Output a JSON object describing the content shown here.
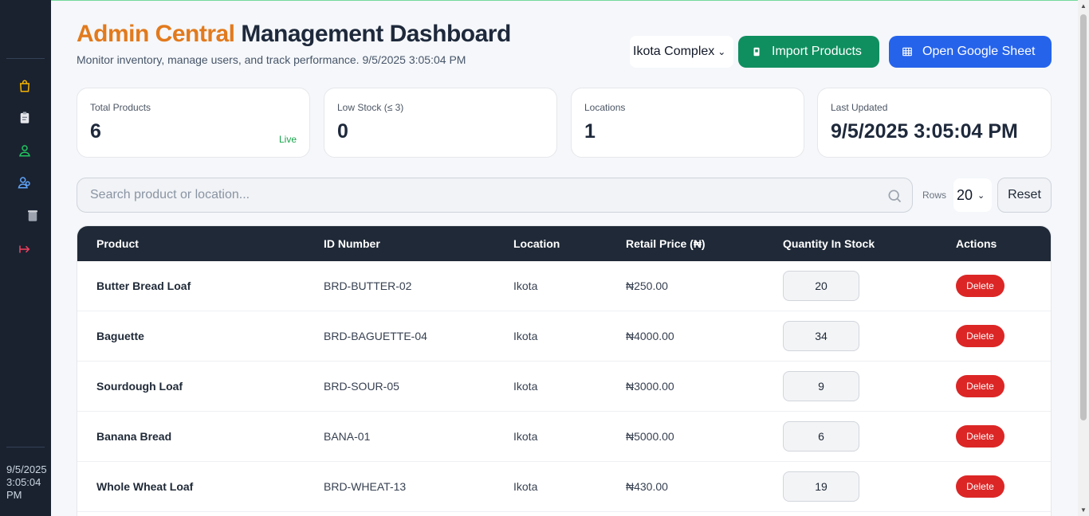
{
  "header": {
    "title_accent": "Admin Central",
    "title_rest": "Management Dashboard",
    "subtitle": "Monitor inventory, manage users, and track performance. 9/5/2025 3:05:04 PM",
    "location_select": "Ikota Complex",
    "import_label": "Import Products",
    "sheet_label": "Open Google Sheet"
  },
  "sidebar": {
    "icons": [
      "bag-icon",
      "clipboard-icon",
      "user-icon",
      "users-icon",
      "trash-icon",
      "logout-icon"
    ],
    "time": "9/5/2025 3:05:04 PM"
  },
  "stats": [
    {
      "label": "Total Products",
      "value": "6",
      "badge": "Live"
    },
    {
      "label": "Low Stock (≤ 3)",
      "value": "0"
    },
    {
      "label": "Locations",
      "value": "1"
    },
    {
      "label": "Last Updated",
      "value": "9/5/2025 3:05:04 PM"
    }
  ],
  "search": {
    "placeholder": "Search product or location..."
  },
  "rows": {
    "label": "Rows",
    "value": "20"
  },
  "reset_label": "Reset",
  "table": {
    "headers": [
      "Product",
      "ID Number",
      "Location",
      "Retail Price (₦)",
      "Quantity In Stock",
      "Actions"
    ],
    "rows": [
      {
        "product": "Butter Bread Loaf",
        "id": "BRD-BUTTER-02",
        "location": "Ikota",
        "price": "₦250.00",
        "qty": "20",
        "action": "Delete"
      },
      {
        "product": "Baguette",
        "id": "BRD-BAGUETTE-04",
        "location": "Ikota",
        "price": "₦4000.00",
        "qty": "34",
        "action": "Delete"
      },
      {
        "product": "Sourdough Loaf",
        "id": "BRD-SOUR-05",
        "location": "Ikota",
        "price": "₦3000.00",
        "qty": "9",
        "action": "Delete"
      },
      {
        "product": "Banana Bread",
        "id": "BANA-01",
        "location": "Ikota",
        "price": "₦5000.00",
        "qty": "6",
        "action": "Delete"
      },
      {
        "product": "Whole Wheat Loaf",
        "id": "BRD-WHEAT-13",
        "location": "Ikota",
        "price": "₦430.00",
        "qty": "19",
        "action": "Delete"
      }
    ]
  },
  "colors": {
    "accent": "#e27a1d",
    "sidebar": "#1a2230",
    "import": "#0f8f5f",
    "sheet": "#2563eb",
    "delete": "#dc2626"
  }
}
